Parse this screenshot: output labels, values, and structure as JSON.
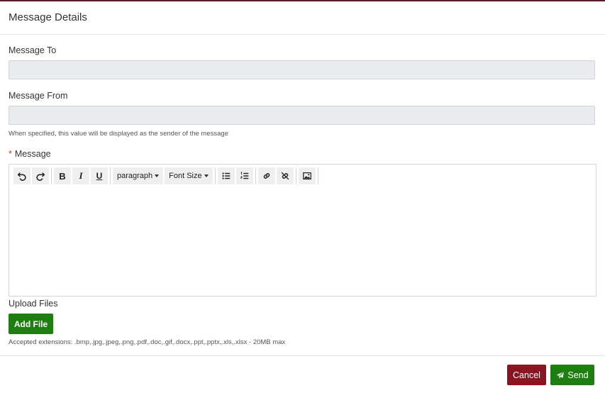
{
  "header": {
    "title": "Message Details"
  },
  "message_to": {
    "label": "Message To",
    "value": ""
  },
  "message_from": {
    "label": "Message From",
    "value": "",
    "help": "When specified, this value will be displayed as the sender of the message"
  },
  "message": {
    "required_mark": "*",
    "label": "Message",
    "toolbar": {
      "paragraph_label": "paragraph",
      "font_size_label": "Font Size",
      "icons": [
        "undo-icon",
        "redo-icon",
        "bold-icon",
        "italic-icon",
        "underline-icon",
        "bullet-list-icon",
        "numbered-list-icon",
        "link-icon",
        "unlink-icon",
        "image-icon"
      ],
      "bold_glyph": "B",
      "italic_glyph": "I",
      "underline_glyph": "U"
    }
  },
  "upload": {
    "label": "Upload Files",
    "button_label": "Add File",
    "help": "Accepted extensions: .bmp,.jpg,.jpeg,.png,.pdf,.doc,.gif,.docx,.ppt,.pptx,.xls,.xlsx - 20MB max"
  },
  "footer": {
    "cancel_label": "Cancel",
    "send_label": "Send"
  },
  "colors": {
    "accent_top": "#5a1f2c",
    "cancel": "#8b1421",
    "primary": "#1e7e10",
    "field_bg": "#e9ecef"
  }
}
